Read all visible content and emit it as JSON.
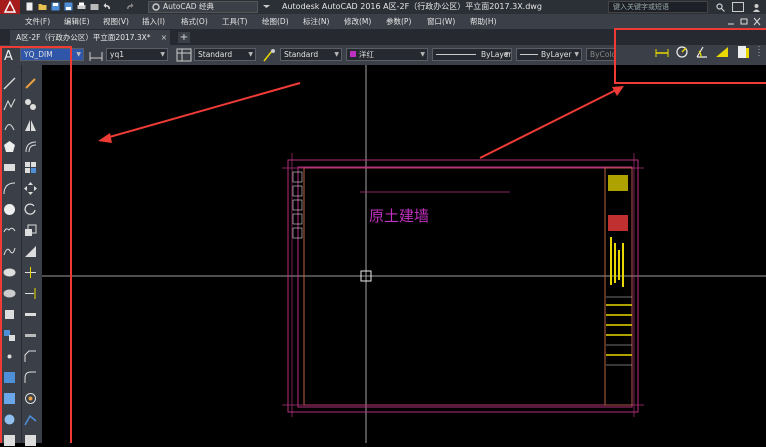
{
  "window": {
    "title": "Autodesk AutoCAD 2016    A区-2F（行政办公区）平立面2017.3X.dwg",
    "workspace": "AutoCAD 经典",
    "search_placeholder": "键入关键字或短语"
  },
  "menu": [
    "文件(F)",
    "编辑(E)",
    "视图(V)",
    "插入(I)",
    "格式(O)",
    "工具(T)",
    "绘图(D)",
    "标注(N)",
    "修改(M)",
    "参数(P)",
    "窗口(W)",
    "帮助(H)"
  ],
  "tabs": {
    "file_tab": "A区-2F（行政办公区）平立面2017.3X*",
    "close": "×",
    "new_tab": "+"
  },
  "properties": {
    "text_style": "YQ_DIM",
    "dim_style": "yq1",
    "table_style": "Standard",
    "multileader_style": "Standard",
    "layer": "洋红",
    "linetype": "ByLayer",
    "lineweight": "ByLayer",
    "color": "ByColor"
  },
  "canvas": {
    "label": "原土建墙"
  },
  "colors": {
    "accent_highlight": "#ef3b36",
    "toolbar_highlight": "#ffdd00",
    "drawing_magenta": "#c030c0",
    "drawing_border": "#b3307c",
    "drawing_yellow": "#e8d800",
    "background": "#000000",
    "chrome": "#3b3f47"
  },
  "icons": {
    "left_toolbar": [
      "line",
      "polyline",
      "arc",
      "rectangle",
      "circle",
      "spline",
      "ellipse",
      "hatch",
      "move",
      "copy",
      "rotate",
      "scale",
      "trim",
      "extend",
      "fillet",
      "array"
    ],
    "dim_toolbar": [
      "linear-dimension",
      "radius-dimension",
      "angular-dimension",
      "baseline-dimension",
      "dimension-style"
    ]
  }
}
